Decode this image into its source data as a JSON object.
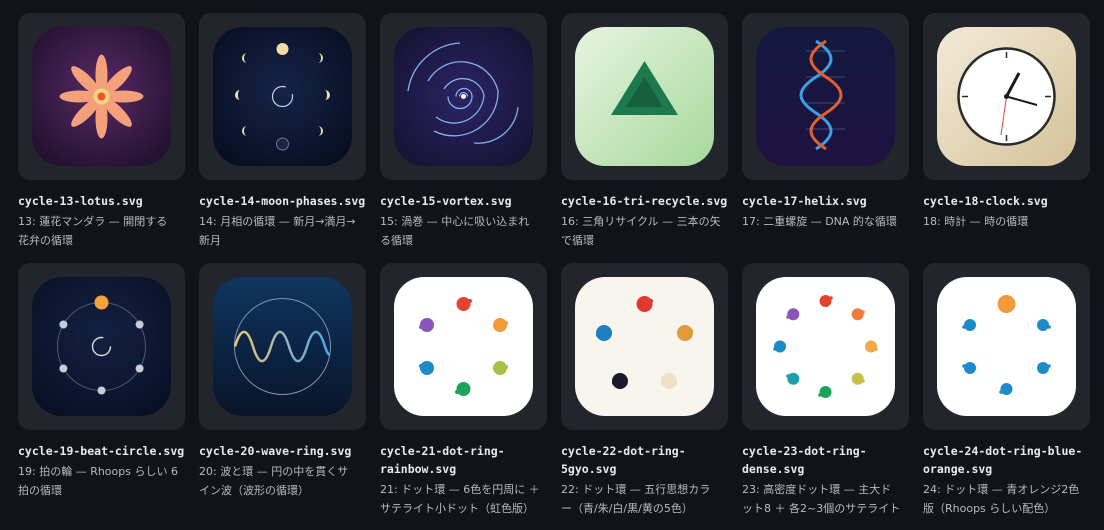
{
  "items": [
    {
      "file": "cycle-13-lotus.svg",
      "desc": "13: 蓮花マンダラ — 開閉する花弁の循環"
    },
    {
      "file": "cycle-14-moon-phases.svg",
      "desc": "14: 月相の循環 — 新月→満月→新月"
    },
    {
      "file": "cycle-15-vortex.svg",
      "desc": "15: 渦巻 — 中心に吸い込まれる循環"
    },
    {
      "file": "cycle-16-tri-recycle.svg",
      "desc": "16: 三角リサイクル — 三本の矢で循環"
    },
    {
      "file": "cycle-17-helix.svg",
      "desc": "17: 二重螺旋 — DNA 的な循環"
    },
    {
      "file": "cycle-18-clock.svg",
      "desc": "18: 時計 — 時の循環"
    },
    {
      "file": "cycle-19-beat-circle.svg",
      "desc": "19: 拍の輪 — Rhoops らしい 6 拍の循環"
    },
    {
      "file": "cycle-20-wave-ring.svg",
      "desc": "20: 波と環 — 円の中を貫くサイン波（波形の循環）"
    },
    {
      "file": "cycle-21-dot-ring-\nrainbow.svg",
      "desc": "21: ドット環 — 6色を円周に ＋ サテライト小ドット（虹色版）"
    },
    {
      "file": "cycle-22-dot-ring-\n5gyo.svg",
      "desc": "22: ドット環 — 五行思想カラー（青/朱/白/黒/黄の5色）"
    },
    {
      "file": "cycle-23-dot-ring-\ndense.svg",
      "desc": "23: 高密度ドット環 — 主大ドット8 ＋ 各2~3個のサテライト"
    },
    {
      "file": "cycle-24-dot-ring-blue-\norange.svg",
      "desc": "24: ドット環 — 青オレンジ2色版（Rhoops らしい配色）"
    }
  ],
  "icons": [
    "lotus-icon",
    "moon-phases-icon",
    "vortex-icon",
    "tri-recycle-icon",
    "helix-icon",
    "clock-icon",
    "beat-circle-icon",
    "wave-ring-icon",
    "dot-ring-rainbow-icon",
    "dot-ring-5gyo-icon",
    "dot-ring-dense-icon",
    "dot-ring-blue-orange-icon"
  ]
}
